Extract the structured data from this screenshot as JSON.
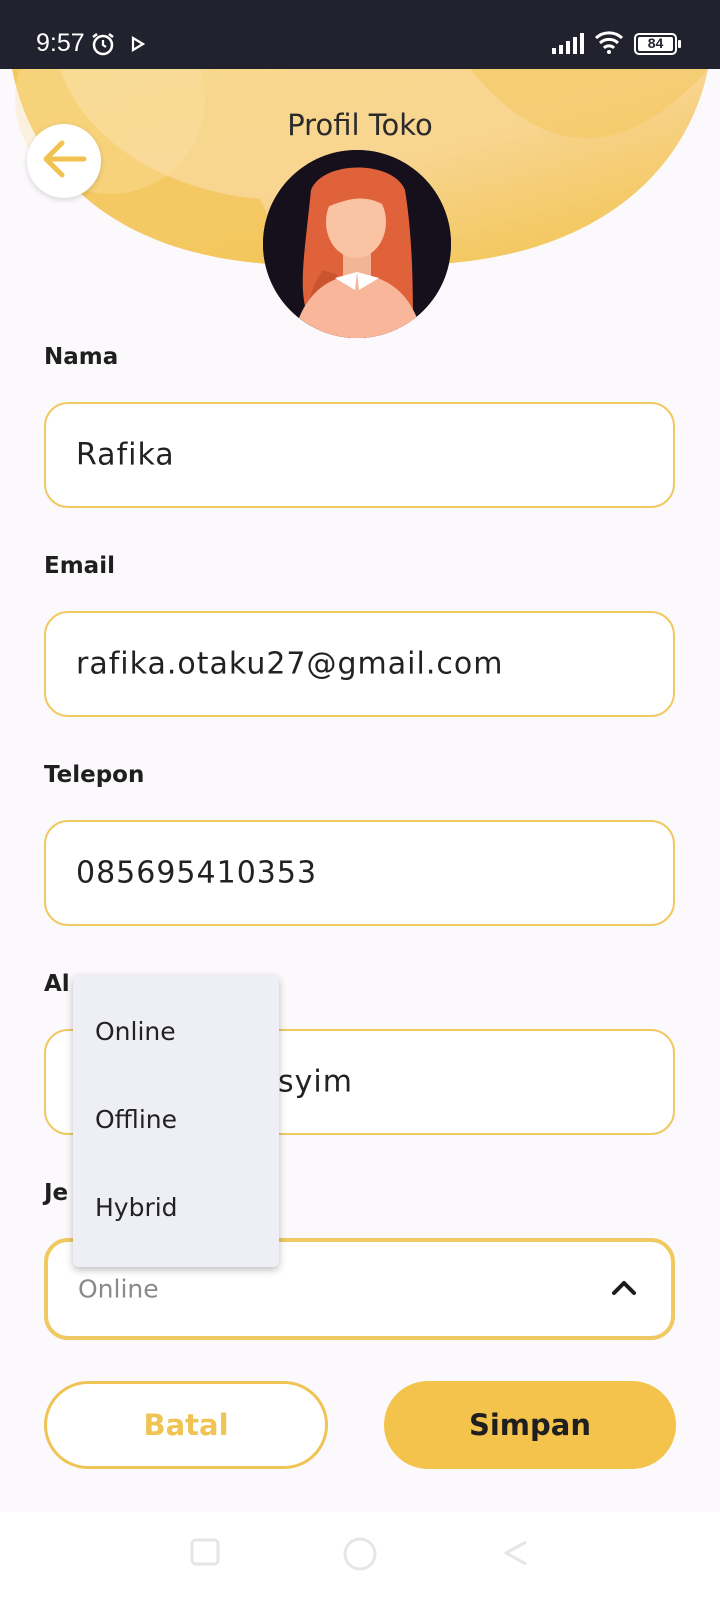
{
  "status_bar": {
    "time": "9:57",
    "battery": "84",
    "icons": [
      "alarm-icon",
      "play-icon",
      "signal-icon",
      "wifi-icon",
      "battery-icon"
    ]
  },
  "header": {
    "title": "Profil Toko",
    "back_icon": "arrow-left-icon"
  },
  "form": {
    "name": {
      "label": "Nama",
      "value": "Rafika"
    },
    "email": {
      "label": "Email",
      "value": "rafika.otaku27@gmail.com"
    },
    "phone": {
      "label": "Telepon",
      "value": "085695410353"
    },
    "address": {
      "label_visible": "Al",
      "value_visible": "syim"
    },
    "type": {
      "label_visible": "Je",
      "selected": "Online",
      "options": [
        "Online",
        "Offline",
        "Hybrid"
      ]
    }
  },
  "buttons": {
    "cancel": "Batal",
    "save": "Simpan"
  },
  "colors": {
    "accent": "#f3c34c",
    "field_border": "#efca62",
    "status_bar": "#21222d",
    "background": "#fcf9fc"
  }
}
